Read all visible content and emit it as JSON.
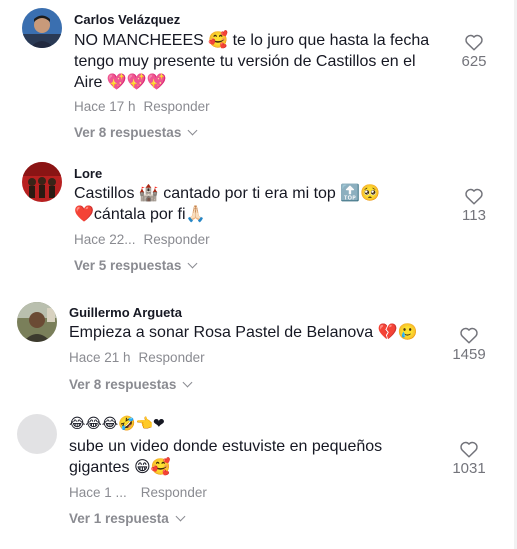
{
  "comments": [
    {
      "username": "Carlos Velázquez",
      "lines": [
        "NO MANCHEEES 🥰 te lo juro que hasta la fecha",
        "tengo muy presente tu versión de Castillos en el",
        "Aire 💖💖💖"
      ],
      "time": "Hace 17 h",
      "reply_label": "Responder",
      "replies_label": "Ver 8 respuestas",
      "likes": "625"
    },
    {
      "username": "Lore",
      "lines": [
        "Castillos 🏰 cantado por ti era mi top 🔝🥺",
        "❤️cántala por fi🙏🏻"
      ],
      "time": "Hace 22...",
      "reply_label": "Responder",
      "replies_label": "Ver 5 respuestas",
      "likes": "113"
    },
    {
      "username": "Guillermo Argueta",
      "lines": [
        "Empieza a sonar Rosa Pastel de Belanova 💔🥲"
      ],
      "time": "Hace 21 h",
      "reply_label": "Responder",
      "replies_label": "Ver 8 respuestas",
      "likes": "1459"
    },
    {
      "username": "😂😂😂🤣👈❤",
      "lines": [
        "sube un video donde estuviste en pequeños",
        "gigantes 😁🥰"
      ],
      "time": "Hace 1 ...",
      "reply_label": "Responder",
      "replies_label": "Ver 1 respuesta",
      "likes": "1031"
    }
  ],
  "icons": {
    "like": "heart-outline-icon",
    "expand": "chevron-down-icon"
  },
  "colors": {
    "text": "#161823",
    "muted": "#8a8b91",
    "count": "#73747b"
  }
}
